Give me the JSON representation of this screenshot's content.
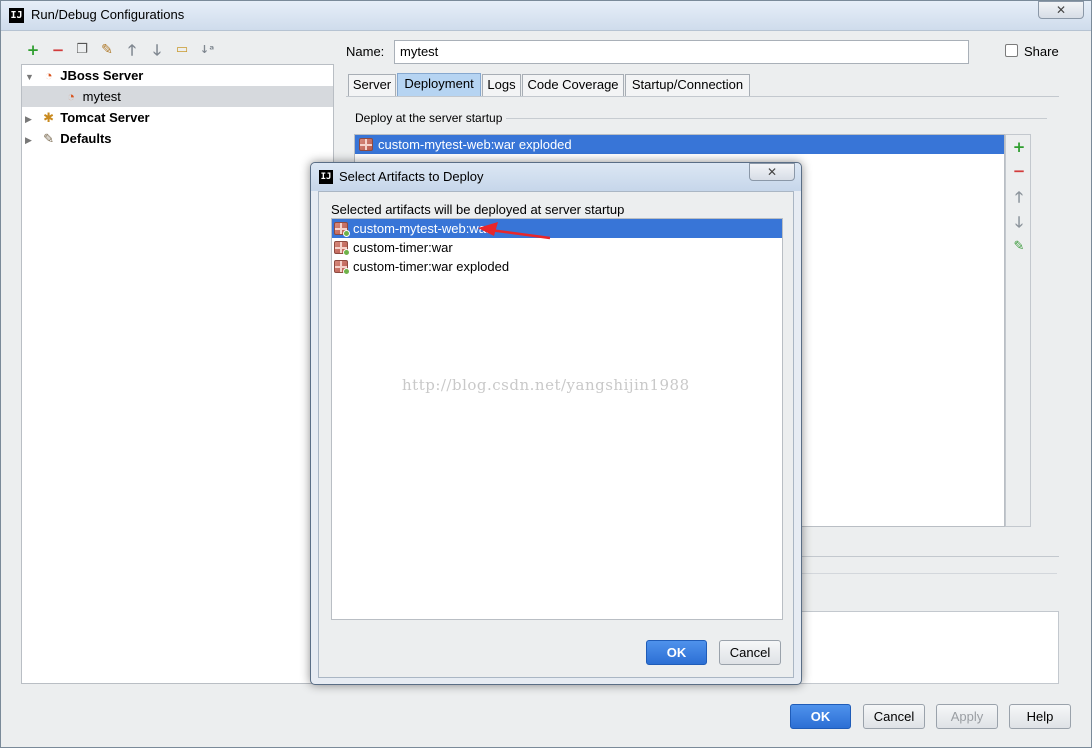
{
  "window": {
    "title": "Run/Debug Configurations",
    "app_icon": "IJ",
    "close_symbol": "✕"
  },
  "toolbar": {
    "icons": [
      "add-icon",
      "remove-icon",
      "copy-icon",
      "wrench-icon",
      "move-up-icon",
      "move-down-icon",
      "folder-icon",
      "sort-icon"
    ]
  },
  "tree": {
    "items": [
      {
        "label": "JBoss Server",
        "expanded": true,
        "bold": true
      },
      {
        "label": "mytest",
        "child": true,
        "selected": true
      },
      {
        "label": "Tomcat Server",
        "expanded": false,
        "bold": true
      },
      {
        "label": "Defaults",
        "expanded": false,
        "bold": true
      }
    ]
  },
  "config": {
    "name_label": "Name:",
    "name_value": "mytest",
    "share_label": "Share",
    "share_checked": false
  },
  "tabs": [
    "Server",
    "Deployment",
    "Logs",
    "Code Coverage",
    "Startup/Connection"
  ],
  "active_tab": "Deployment",
  "deployment": {
    "group_title": "Deploy at the server startup",
    "items": [
      "custom-mytest-web:war exploded"
    ]
  },
  "footer": {
    "ok": "OK",
    "cancel": "Cancel",
    "apply": "Apply",
    "help": "Help"
  },
  "modal": {
    "title": "Select Artifacts to Deploy",
    "description": "Selected artifacts will be deployed at server startup",
    "artifacts": [
      "custom-mytest-web:war",
      "custom-timer:war",
      "custom-timer:war exploded"
    ],
    "selected_index": 0,
    "ok": "OK",
    "cancel": "Cancel",
    "watermark": "http://blog.csdn.net/yangshijin1988"
  },
  "colors": {
    "selection": "#3875d7",
    "primary_button": "#2c6fd4",
    "add": "#2e9e2e",
    "remove": "#d23b3b",
    "annotation_arrow": "#e8262a"
  }
}
